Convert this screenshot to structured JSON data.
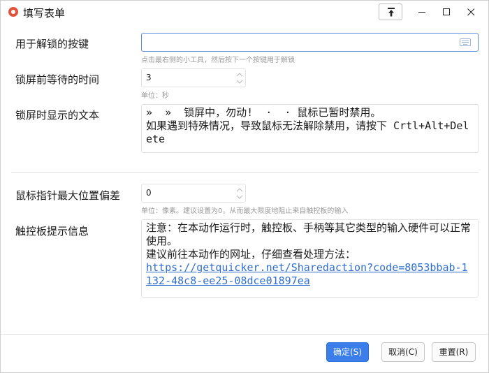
{
  "window": {
    "title": "填写表单"
  },
  "fields": {
    "unlock_key": {
      "label": "用于解锁的按键",
      "value": "",
      "hint": "点击最右侧的小工具，然后按下一个按键用于解锁"
    },
    "wait_time": {
      "label": "锁屏前等待的时间",
      "value": "3",
      "hint": "单位：秒"
    },
    "lock_text": {
      "label": "锁屏时显示的文本",
      "value": "»  »  锁屏中，勿动!  ·  · 鼠标已暂时禁用。\n如果遇到特殊情况，导致鼠标无法解除禁用，请按下 Crtl+Alt+Delete"
    },
    "max_offset": {
      "label": "鼠标指针最大位置偏差",
      "value": "0",
      "hint": "单位：像素。建议设置为0，从而最大限度地阻止来自触控板的输入"
    },
    "touchpad_info": {
      "label": "触控板提示信息",
      "line1": "注意：在本动作运行时，触控板、手柄等其它类型的输入硬件可以正常使用。",
      "line2": "建议前往本动作的网址，仔细查看处理方法：",
      "url": "https://getquicker.net/Sharedaction?code=8053bbab-1132-48c8-ee25-08dce01897ea"
    }
  },
  "buttons": {
    "ok": "确定(S)",
    "cancel": "取消(C)",
    "reset": "重置(R)"
  },
  "colors": {
    "accent": "#3b7de9",
    "link": "#2f6fd1",
    "app_icon": "#e0533d"
  }
}
